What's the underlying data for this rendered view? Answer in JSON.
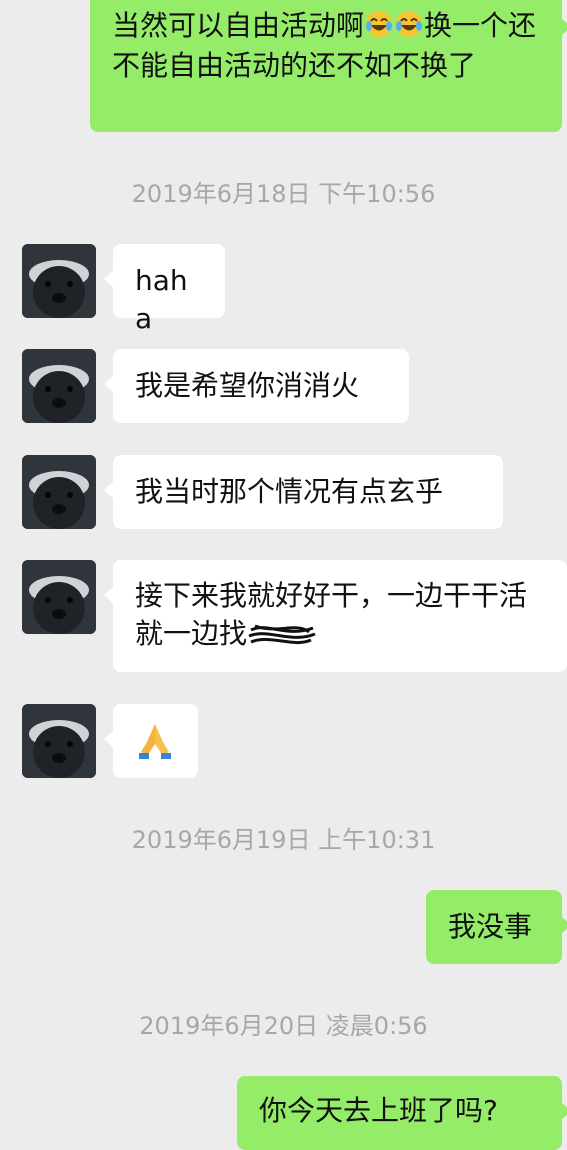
{
  "messages": {
    "m1": {
      "text_a": "当然可以自由活动啊",
      "text_b": "换一个还不能自由活动的还不如不换了",
      "emoji": "face-with-tears-of-joy-icon"
    },
    "ts1": "2019年6月18日 下午10:56",
    "m2": "haha",
    "m3": "我是希望你消消火",
    "m4": "我当时那个情况有点玄乎",
    "m5": {
      "text": "接下来我就好好干，一边干干活就一边找",
      "redacted": "redacted-scribble"
    },
    "m6": {
      "emoji": "folded-hands-icon"
    },
    "ts2": "2019年6月19日 上午10:31",
    "m7": "我没事",
    "ts3": "2019年6月20日 凌晨0:56",
    "m8": "你今天去上班了吗?"
  },
  "colors": {
    "background": "#ececec",
    "incoming_bubble": "#ffffff",
    "outgoing_bubble": "#95ec69",
    "timestamp_text": "#a7a7a7"
  }
}
